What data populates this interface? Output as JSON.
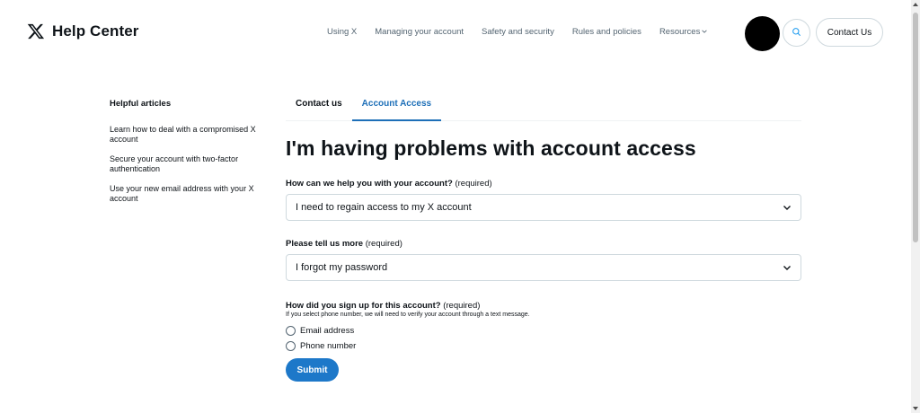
{
  "header": {
    "brand": "Help Center",
    "nav": [
      {
        "label": "Using X"
      },
      {
        "label": "Managing your account"
      },
      {
        "label": "Safety and security"
      },
      {
        "label": "Rules and policies"
      },
      {
        "label": "Resources"
      }
    ],
    "contact_label": "Contact Us",
    "icons": {
      "logo": "x-logo-icon",
      "search": "search-icon",
      "resources_chevron": "chevron-down-icon"
    }
  },
  "sidebar": {
    "heading": "Helpful articles",
    "articles": [
      {
        "label": "Learn how to deal with a compromised X account"
      },
      {
        "label": "Secure your account with two-factor authentication"
      },
      {
        "label": "Use your new email address with your X account"
      }
    ]
  },
  "main": {
    "tabs": [
      {
        "label": "Contact us",
        "active": false
      },
      {
        "label": "Account Access",
        "active": true
      }
    ],
    "title": "I'm having problems with account access",
    "q1": {
      "label": "How can we help you with your account?",
      "required": "(required)",
      "value": "I need to regain access to my X account"
    },
    "q2": {
      "label": "Please tell us more",
      "required": "(required)",
      "value": "I forgot my password"
    },
    "q3": {
      "label": "How did you sign up for this account?",
      "required": "(required)",
      "hint": "If you select phone number, we will need to verify your account through a text message.",
      "options": [
        {
          "label": "Email address"
        },
        {
          "label": "Phone number"
        }
      ]
    },
    "submit_label": "Submit"
  },
  "colors": {
    "accent": "#1d78c9",
    "tab_active": "#1d6fb8",
    "text": "#0f1419",
    "muted": "#536471",
    "border": "#cfd9de"
  }
}
